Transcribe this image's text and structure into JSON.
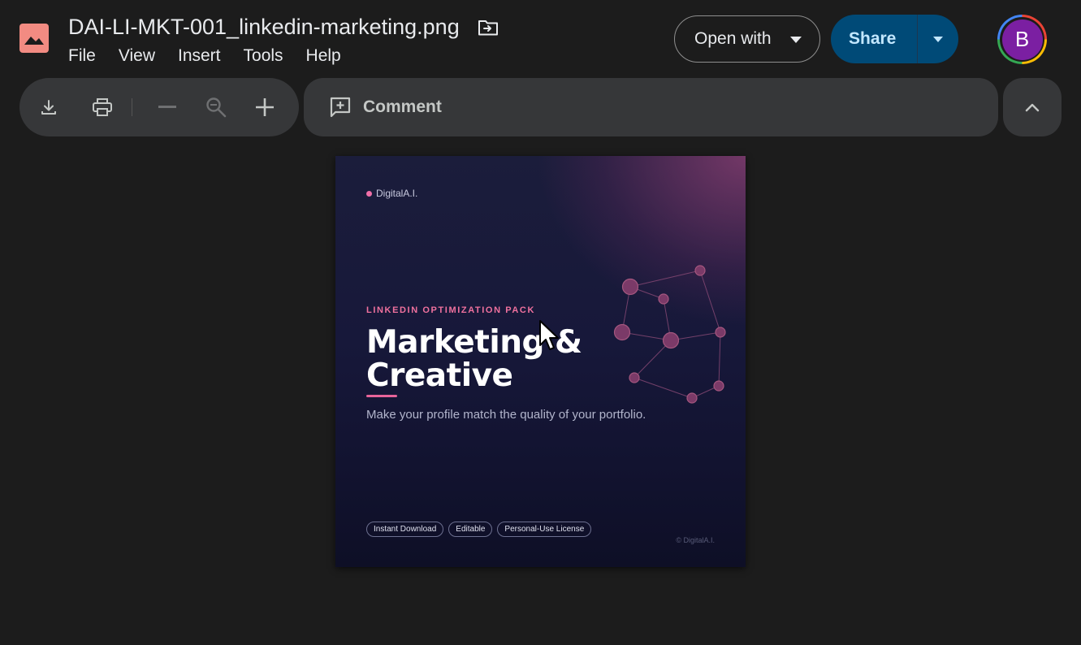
{
  "header": {
    "file_name": "DAI-LI-MKT-001_linkedin-marketing.png",
    "menu": [
      "File",
      "View",
      "Insert",
      "Tools",
      "Help"
    ],
    "open_with_label": "Open with",
    "share_label": "Share",
    "avatar_initial": "B",
    "avatar_color": "#7b1fa2",
    "share_color": "#004a77"
  },
  "toolbar": {
    "icons": [
      "download-icon",
      "print-icon",
      "zoom-out-icon",
      "zoom-reset-icon",
      "zoom-in-icon"
    ],
    "comment_label": "Comment",
    "collapse_icon": "chevron-up-icon"
  },
  "preview": {
    "brand": "DigitalA.I.",
    "eyebrow": "LINKEDIN OPTIMIZATION PACK",
    "headline_line1": "Marketing &",
    "headline_line2": "Creative",
    "tagline": "Make your profile match the quality of your portfolio.",
    "badges": [
      "Instant Download",
      "Editable",
      "Personal-Use License"
    ],
    "copyright": "© DigitalA.I.",
    "accent_color": "#f06fa8"
  }
}
